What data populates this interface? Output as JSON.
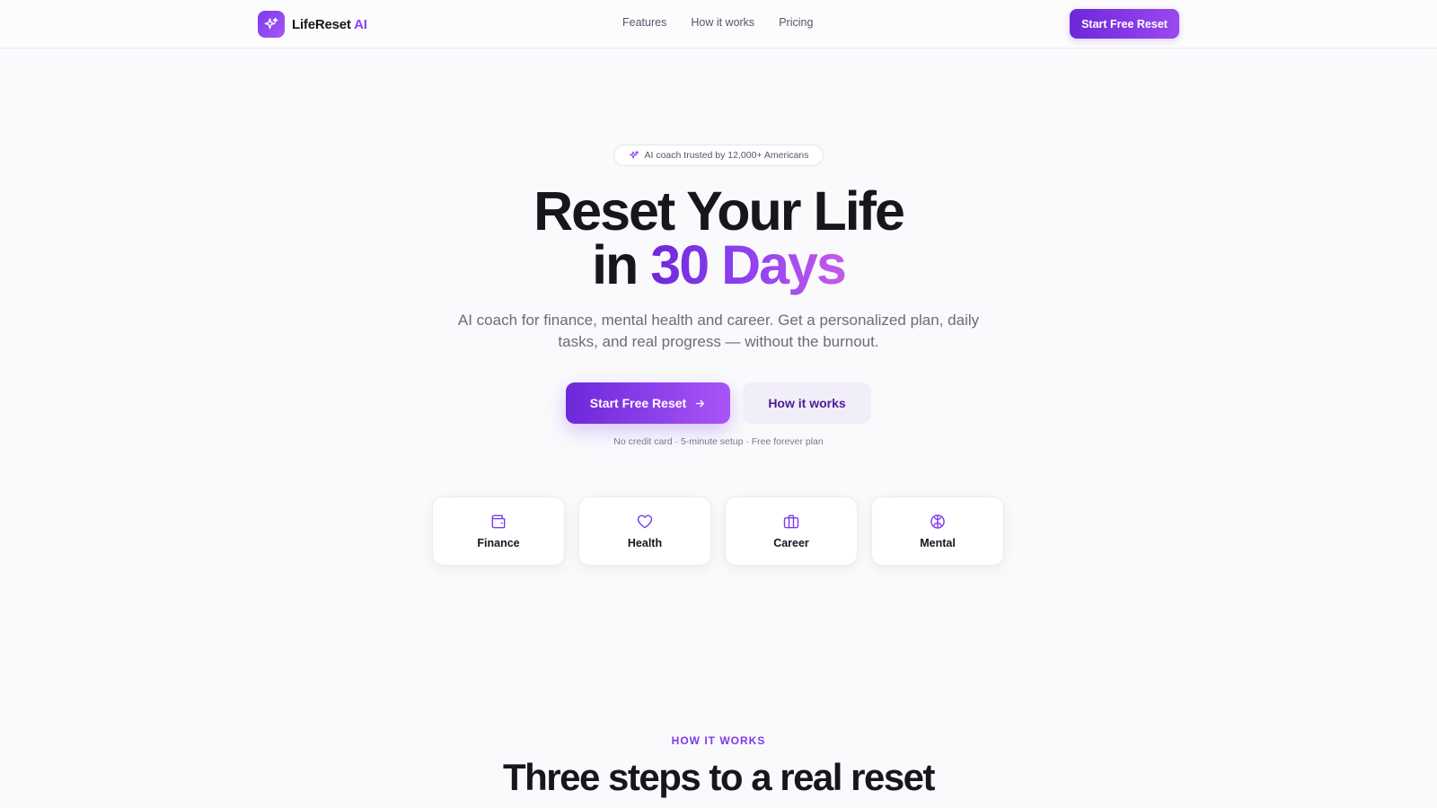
{
  "brand": {
    "name": "LifeReset",
    "suffix": "AI",
    "logo_icon": "sparkles-icon",
    "primary_color": "#7c3aed",
    "accent_color": "#a855f7"
  },
  "nav": {
    "links": [
      "Features",
      "How it works",
      "Pricing"
    ],
    "cta_label": "Start Free Reset"
  },
  "hero": {
    "badge_icon": "sparkles-icon",
    "badge_text": "AI coach trusted by 12,000+ Americans",
    "headline_line1": "Reset Your Life",
    "headline_line2_prefix": "in",
    "headline_line2_highlight": "30 Days",
    "subheadline": "AI coach for finance, mental health and career. Get a personalized plan, daily tasks, and real progress — without the burnout.",
    "primary_cta": "Start Free Reset",
    "primary_cta_icon": "arrow-right-icon",
    "secondary_cta": "How it works",
    "fineprint": "No credit card · 5-minute setup · Free forever plan"
  },
  "categories": [
    {
      "label": "Finance",
      "icon": "wallet-icon"
    },
    {
      "label": "Health",
      "icon": "heart-icon"
    },
    {
      "label": "Career",
      "icon": "briefcase-icon"
    },
    {
      "label": "Mental",
      "icon": "brain-icon"
    }
  ],
  "how_it_works": {
    "eyebrow": "HOW IT WORKS",
    "title": "Three steps to a real reset"
  }
}
